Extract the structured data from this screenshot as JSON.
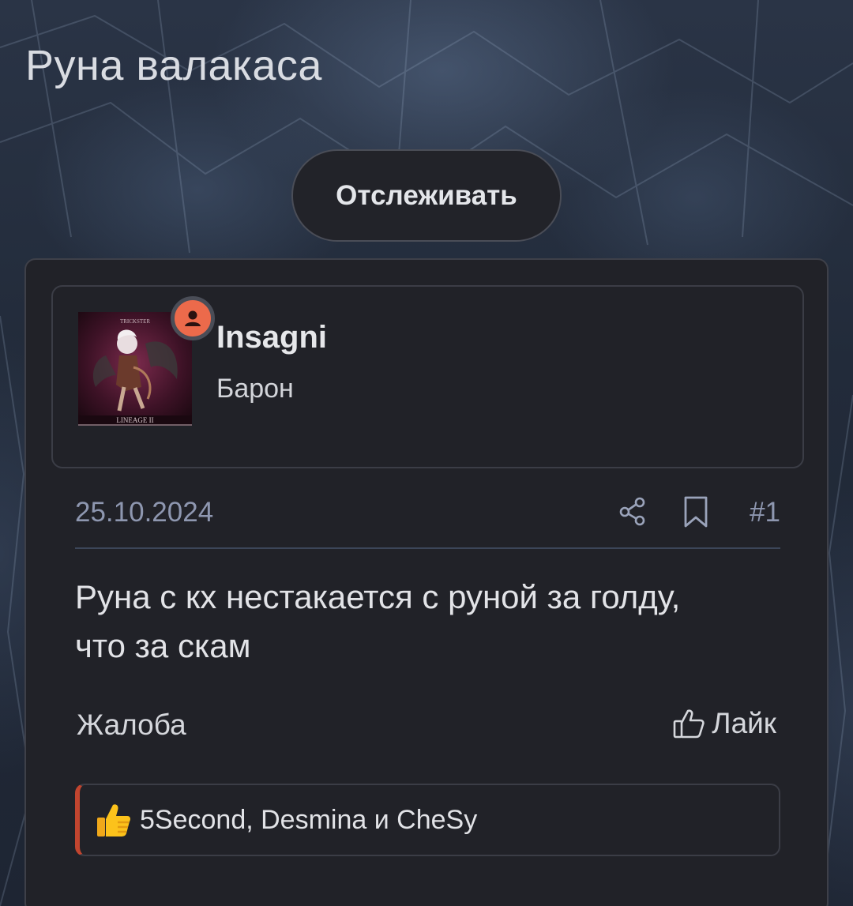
{
  "thread": {
    "title": "Руна валакаса",
    "follow_label": "Отслеживать"
  },
  "post": {
    "author": {
      "username": "Insagni",
      "rank": "Барон",
      "avatar_text_top": "TRICKSTER",
      "avatar_text_bottom": "LINEAGE II"
    },
    "date": "25.10.2024",
    "number": "#1",
    "body_line1": "Руна с кх нестакается с руной за голду,",
    "body_line2": "что за скам",
    "report_label": "Жалоба",
    "like_label": "Лайк",
    "reactions_users": "5Second, Desmina и CheSy"
  },
  "icons": {
    "share": "share-icon",
    "bookmark": "bookmark-icon",
    "like": "thumbs-up-icon",
    "user_status": "user-icon",
    "reaction": "thumbs-up-emoji-icon"
  },
  "colors": {
    "card_bg": "#212228",
    "status_dot": "#ec6a4b",
    "reaction_accent": "#c2452f",
    "meta_text": "#8e97b0"
  }
}
